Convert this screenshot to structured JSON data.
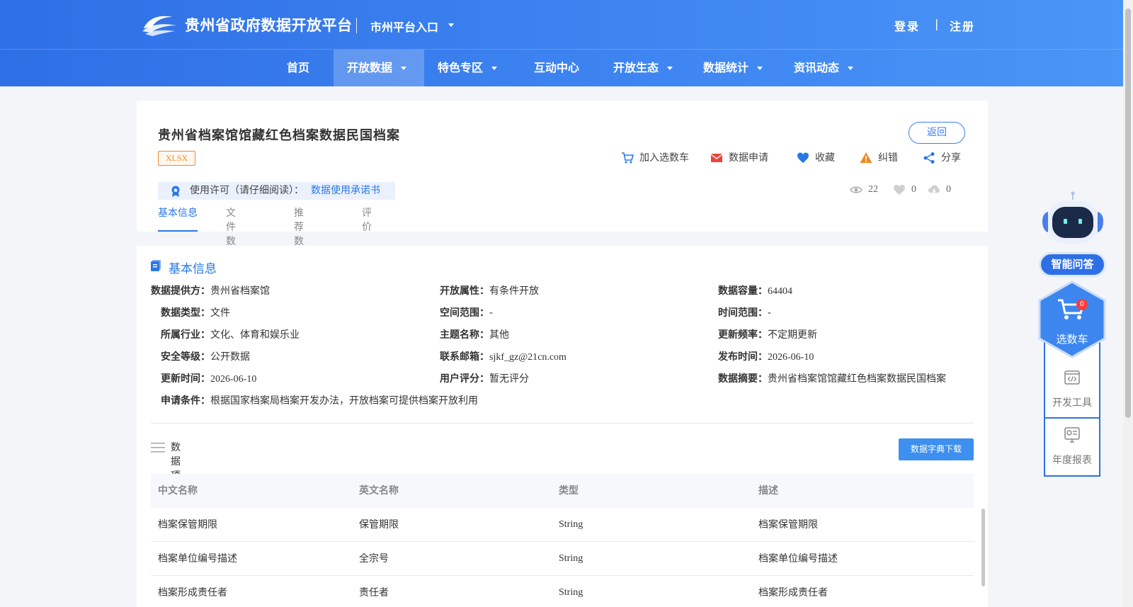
{
  "header": {
    "site_title": "贵州省政府数据开放平台",
    "city_entry": "市州平台入口",
    "login": "登录",
    "separator": "|",
    "register": "注册"
  },
  "nav": {
    "items": [
      {
        "label": "首页",
        "dropdown": false
      },
      {
        "label": "开放数据",
        "dropdown": true,
        "active": true
      },
      {
        "label": "特色专区",
        "dropdown": true
      },
      {
        "label": "互动中心",
        "dropdown": false
      },
      {
        "label": "开放生态",
        "dropdown": true
      },
      {
        "label": "数据统计",
        "dropdown": true
      },
      {
        "label": "资讯动态",
        "dropdown": true
      }
    ]
  },
  "dataset": {
    "title": "贵州省档案馆馆藏红色档案数据民国档案",
    "format": "XLSX",
    "license_label": "使用许可（请仔细阅读）：",
    "license_link": "数据使用承诺书",
    "back_label": "返回",
    "actions": {
      "add_cart": "加入选数车",
      "apply": "数据申请",
      "favorite": "收藏",
      "report_error": "纠错",
      "share": "分享"
    },
    "stats": {
      "views": "22",
      "likes": "0",
      "downloads": "0"
    },
    "tabs": [
      "基本信息",
      "文件数据",
      "推荐数据",
      "评价"
    ]
  },
  "basic_info": {
    "heading": "基本信息",
    "fields": {
      "provider": {
        "label": "数据提供方：",
        "value": "贵州省档案馆"
      },
      "open_attr": {
        "label": "开放属性：",
        "value": "有条件开放"
      },
      "capacity": {
        "label": "数据容量：",
        "value": "64404"
      },
      "data_type": {
        "label": "数据类型：",
        "value": "文件"
      },
      "spatial": {
        "label": "空间范围：",
        "value": "-"
      },
      "temporal": {
        "label": "时间范围：",
        "value": "-"
      },
      "industry": {
        "label": "所属行业：",
        "value": "文化、体育和娱乐业"
      },
      "theme": {
        "label": "主题名称：",
        "value": "其他"
      },
      "frequency": {
        "label": "更新频率：",
        "value": "不定期更新"
      },
      "security": {
        "label": "安全等级：",
        "value": "公开数据"
      },
      "email": {
        "label": "联系邮箱：",
        "value": "sjkf_gz@21cn.com"
      },
      "published": {
        "label": "发布时间：",
        "value": "2026-06-10"
      },
      "updated": {
        "label": "更新时间：",
        "value": "2026-06-10"
      },
      "rating": {
        "label": "用户评分：",
        "value": "暂无评分"
      },
      "summary": {
        "label": "数据摘要：",
        "value": "贵州省档案馆馆藏红色档案数据民国档案"
      },
      "conditions": {
        "label": "申请条件：",
        "value": "根据国家档案局档案开发办法，开放档案可提供档案开放利用"
      }
    }
  },
  "data_items": {
    "heading": "数据项",
    "download_label": "数据字典下载",
    "columns": [
      "中文名称",
      "英文名称",
      "类型",
      "描述"
    ],
    "rows": [
      [
        "档案保管期限",
        "保管期限",
        "String",
        "档案保管期限"
      ],
      [
        "档案单位编号描述",
        "全宗号",
        "String",
        "档案单位编号描述"
      ],
      [
        "档案形成责任者",
        "责任者",
        "String",
        "档案形成责任者"
      ]
    ]
  },
  "side": {
    "ai_label": "智能问答",
    "cart_label": "选数车",
    "cart_count": "0",
    "dev_tools": "开发工具",
    "annual_report": "年度报表"
  },
  "colors": {
    "brand_blue": "#2f6fe6",
    "link_blue": "#2a77e6",
    "format_orange": "#f08a24",
    "alert_red": "#e8453c"
  }
}
